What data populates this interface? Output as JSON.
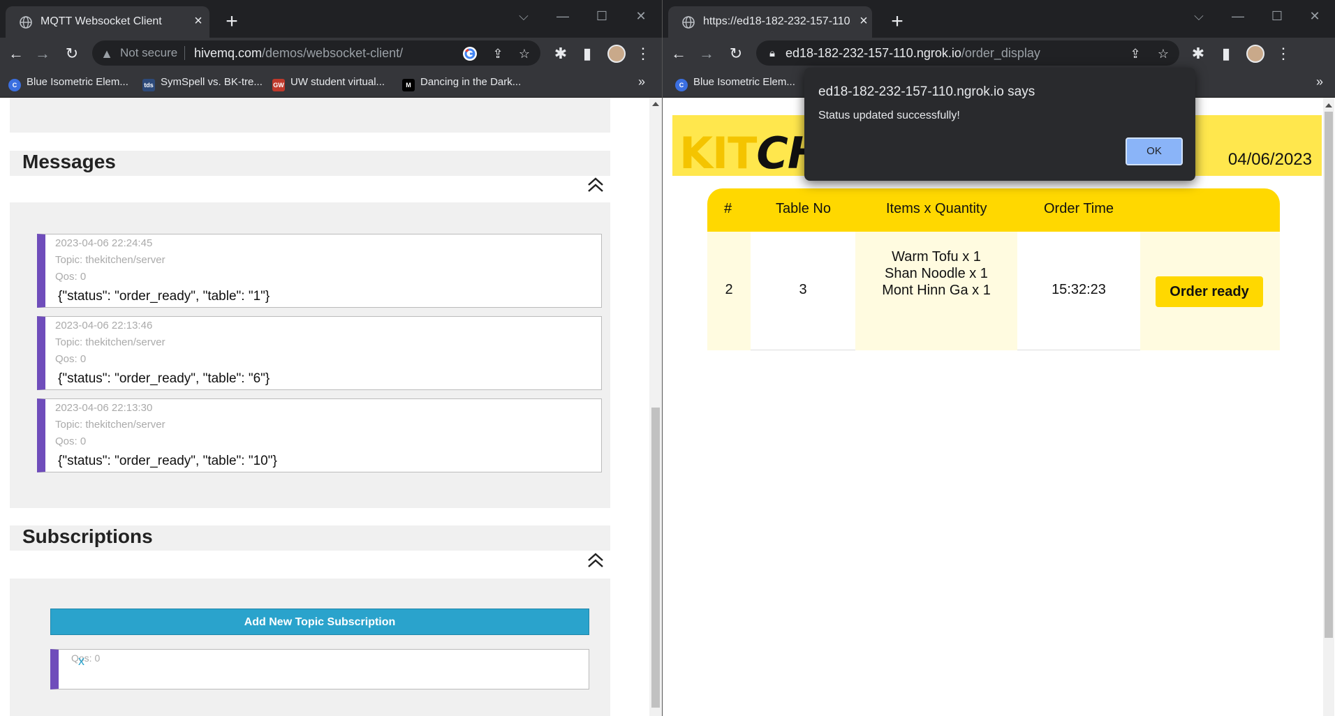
{
  "left_window": {
    "tab_title": "MQTT Websocket Client",
    "security_label": "Not secure",
    "url_host": "hivemq.com",
    "url_path": "/demos/websocket-client/",
    "bookmarks": [
      "Blue Isometric Elem...",
      "SymSpell vs. BK-tre...",
      "UW student virtual...",
      "Dancing in the Dark..."
    ],
    "bookmark_icons": [
      "C",
      "tds",
      "GW",
      "M"
    ],
    "messages_title": "Messages",
    "messages": [
      {
        "timestamp": "2023-04-06 22:24:45",
        "topic": "Topic: thekitchen/server",
        "qos": "Qos: 0",
        "payload": "{\"status\": \"order_ready\", \"table\": \"1\"}"
      },
      {
        "timestamp": "2023-04-06 22:13:46",
        "topic": "Topic: thekitchen/server",
        "qos": "Qos: 0",
        "payload": "{\"status\": \"order_ready\", \"table\": \"6\"}"
      },
      {
        "timestamp": "2023-04-06 22:13:30",
        "topic": "Topic: thekitchen/server",
        "qos": "Qos: 0",
        "payload": "{\"status\": \"order_ready\", \"table\": \"10\"}"
      }
    ],
    "subscriptions_title": "Subscriptions",
    "add_subscription_label": "Add New Topic Subscription",
    "subscription_qos": "Qos: 0",
    "subscription_remove": "x"
  },
  "right_window": {
    "tab_title": "https://ed18-182-232-157-110.ngrok.io/order_display",
    "url_host": "ed18-182-232-157-110.ngrok.io",
    "url_path": "/order_display",
    "bookmarks": [
      "Blue Isometric Elem..."
    ],
    "logo_text_yellow": "KIT",
    "logo_text_black": "CHE",
    "date": "04/06/2023",
    "table_headers": [
      "#",
      "Table No",
      "Items x Quantity",
      "Order Time"
    ],
    "orders": [
      {
        "number": "2",
        "table_no": "3",
        "items": [
          "Warm Tofu x 1",
          "Shan Noodle x 1",
          "Mont Hinn Ga x 1"
        ],
        "order_time": "15:32:23",
        "action_label": "Order ready"
      }
    ]
  },
  "dialog": {
    "title": "ed18-182-232-157-110.ngrok.io says",
    "message": "Status updated successfully!",
    "ok_label": "OK"
  },
  "colors": {
    "message_accent": "#6f4dbb",
    "subscribe_button": "#2aa3cc",
    "kitchen_yellow": "#ffd800",
    "dialog_ok": "#8ab4f8"
  }
}
